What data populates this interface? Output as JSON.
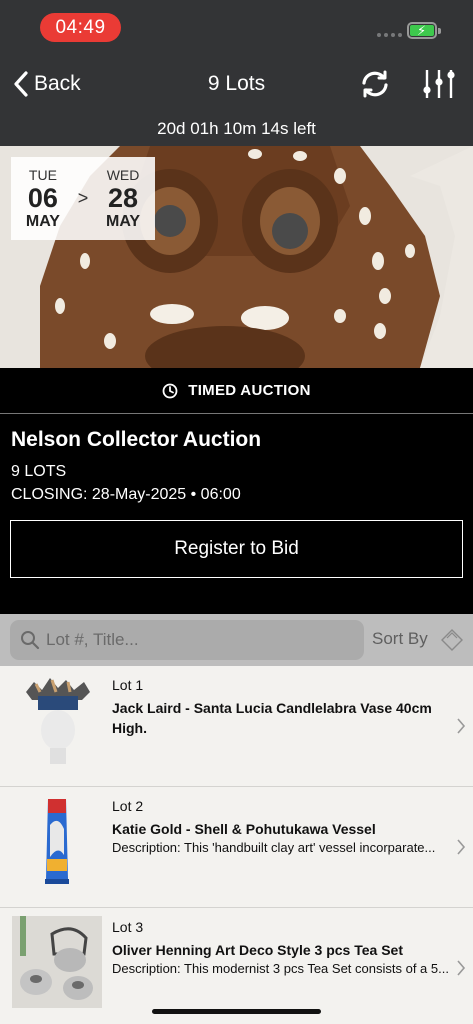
{
  "status_bar": {
    "time": "04:49"
  },
  "nav": {
    "back_label": "Back",
    "title": "9 Lots",
    "countdown": "20d 01h 10m 14s left"
  },
  "hero": {
    "start": {
      "dow": "TUE",
      "day": "06",
      "month": "MAY"
    },
    "separator": ">",
    "end": {
      "dow": "WED",
      "day": "28",
      "month": "MAY"
    }
  },
  "auction": {
    "type_label": "TIMED AUCTION",
    "title": "Nelson Collector Auction",
    "lots_count": "9 LOTS",
    "closing": "CLOSING: 28-May-2025 • 06:00",
    "register_label": "Register to Bid"
  },
  "search": {
    "placeholder": "Lot #, Title...",
    "sort_label": "Sort By"
  },
  "lots": [
    {
      "lot_no": "Lot 1",
      "title": "Jack Laird - Santa Lucia Candlelabra Vase 40cm High.",
      "description": ""
    },
    {
      "lot_no": "Lot 2",
      "title": "Katie Gold - Shell & Pohutukawa Vessel",
      "description": "Description: This 'handbuilt clay art' vessel incorparate..."
    },
    {
      "lot_no": "Lot 3",
      "title": "Oliver Henning Art Deco Style 3 pcs Tea Set",
      "description": "Description: This modernist 3 pcs Tea Set consists of a 5..."
    }
  ],
  "colors": {
    "header_bg": "#333436",
    "time_pill": "#ea3b35",
    "battery": "#3ec94d",
    "info_bg": "#000000",
    "search_bg": "#bdbdbd",
    "list_bg": "#f3f2ef"
  },
  "icons": [
    "chevron-left-icon",
    "refresh-icon",
    "sliders-icon",
    "clock-icon",
    "search-icon",
    "sort-icon",
    "chevron-right-icon",
    "battery-icon",
    "signal-icon"
  ]
}
